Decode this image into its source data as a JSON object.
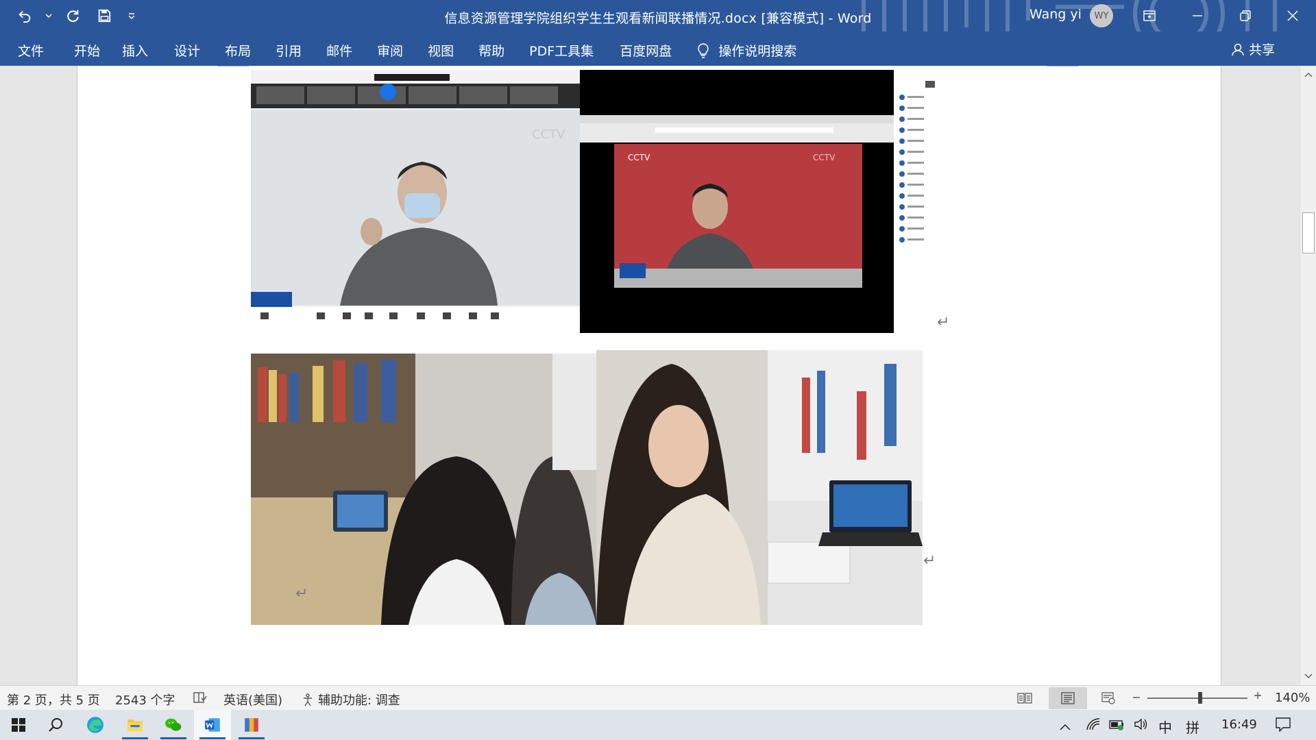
{
  "window": {
    "title": "信息资源管理学院组织学生生观看新闻联播情况.docx [兼容模式]  -  Word",
    "user_name": "Wang yi",
    "user_initials": "WY"
  },
  "quick_access": [
    "undo-icon",
    "redo-icon",
    "save-icon",
    "customize-icon"
  ],
  "ribbon": {
    "tabs": [
      "文件",
      "开始",
      "插入",
      "设计",
      "布局",
      "引用",
      "邮件",
      "审阅",
      "视图",
      "帮助",
      "PDF工具集",
      "百度网盘",
      "操作说明搜索"
    ],
    "share_label": "共享"
  },
  "document": {
    "paragraph_mark": "↵",
    "images": [
      "cctv-meeting-screenshot-1",
      "cctv-browser-screenshot-2",
      "students-watching-tablet-photo",
      "student-watching-laptop-photo"
    ]
  },
  "status_bar": {
    "page": "第 2 页，共 5 页",
    "words": "2543 个字",
    "language": "英语(美国)",
    "accessibility": "辅助功能: 调查",
    "zoom": "140%"
  },
  "taskbar": {
    "apps": [
      "start-icon",
      "search-icon",
      "edge-icon",
      "file-explorer-icon",
      "wechat-icon",
      "word-icon",
      "archive-icon"
    ],
    "ime_lang": "中",
    "ime_mode": "拼",
    "time": "16:49"
  },
  "colors": {
    "accent": "#2b579a",
    "word_blue": "#185abd"
  }
}
